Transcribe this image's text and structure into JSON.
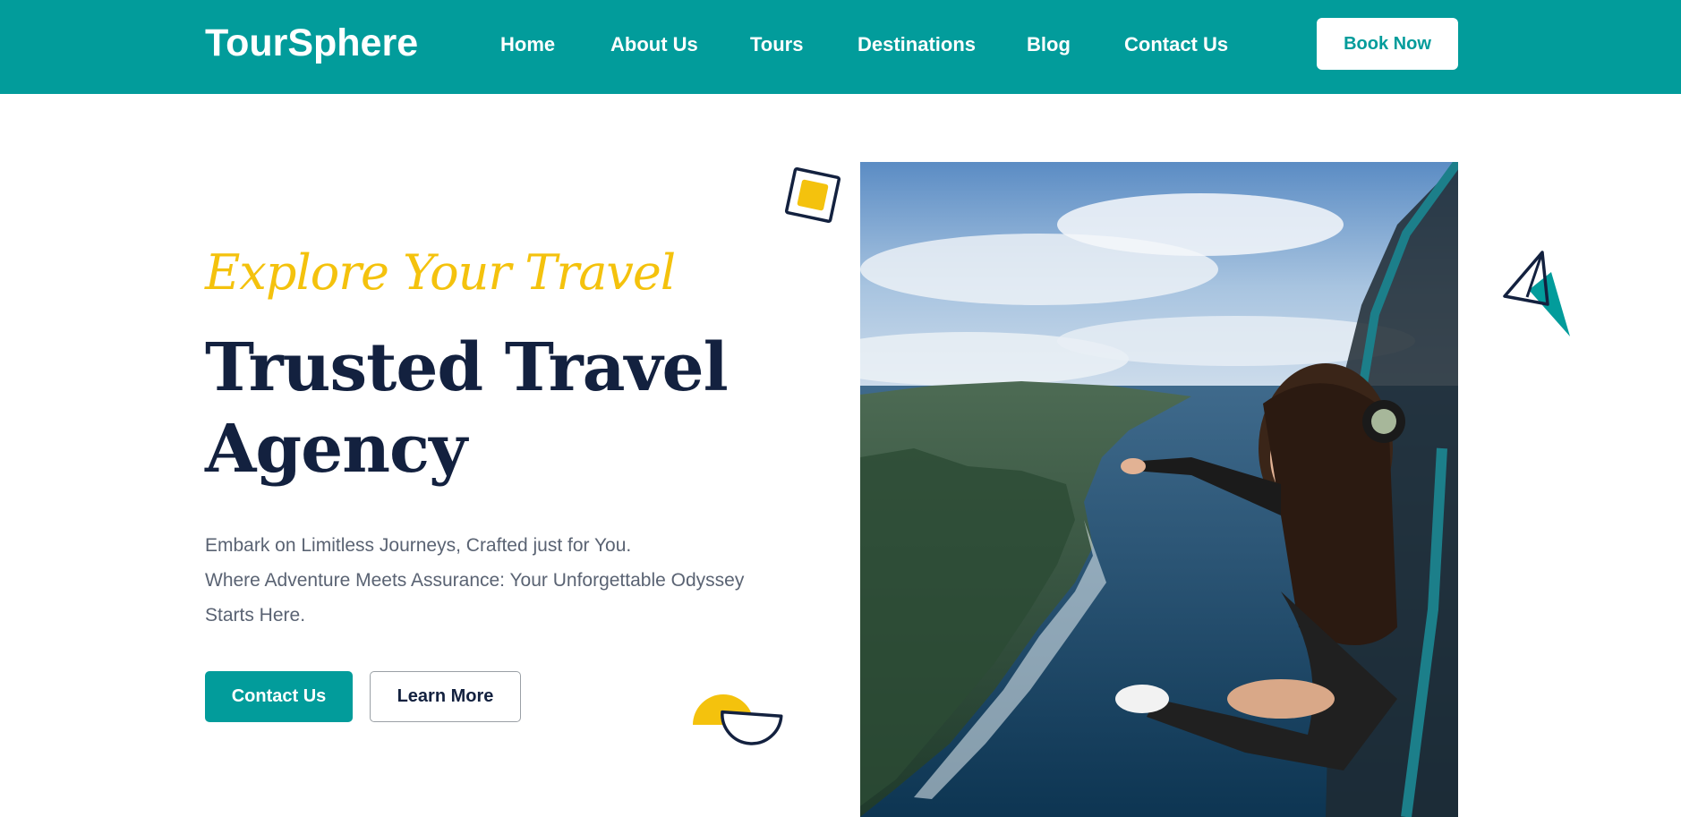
{
  "header": {
    "logo": "TourSphere",
    "nav": [
      "Home",
      "About Us",
      "Tours",
      "Destinations",
      "Blog",
      "Contact Us"
    ],
    "cta": "Book Now"
  },
  "hero": {
    "tagline": "Explore Your Travel",
    "title_line1": "Trusted Travel",
    "title_line2": "Agency",
    "desc_line1": "Embark on Limitless Journeys, Crafted just for You.",
    "desc_line2": "Where Adventure Meets Assurance: Your Unforgettable Odyssey",
    "desc_line3": "Starts Here.",
    "primary_button": "Contact Us",
    "secondary_button": "Learn More"
  },
  "colors": {
    "brand": "#029c9b",
    "accent": "#f4c20d",
    "heading": "#13213f",
    "text": "#5a6373"
  },
  "icons": [
    "square-shape-icon",
    "triangle-shape-icon",
    "half-circle-shape-icon"
  ]
}
